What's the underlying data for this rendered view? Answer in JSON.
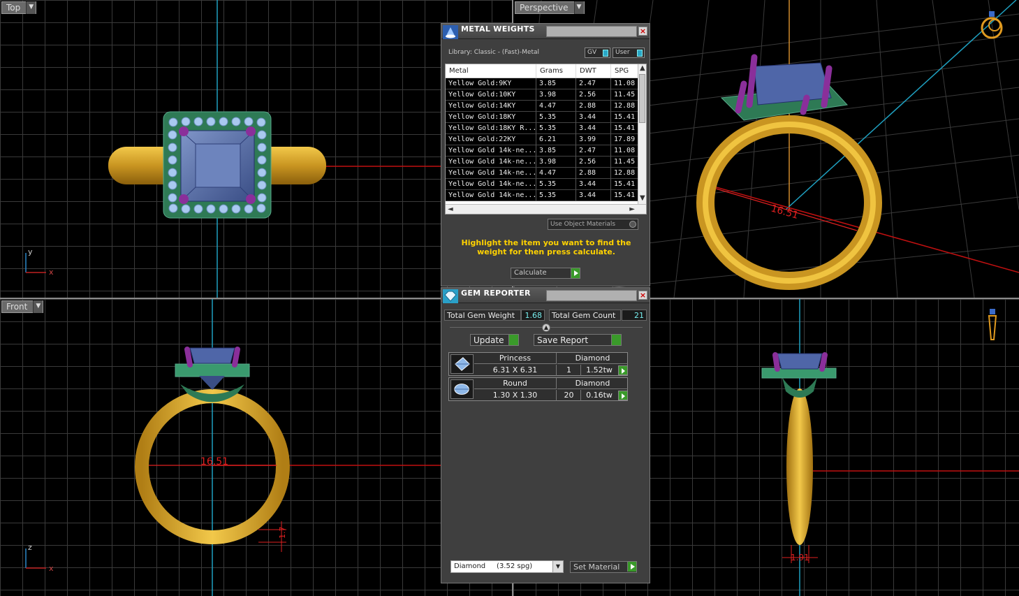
{
  "viewports": {
    "top": {
      "label": "Top",
      "axis_a": "y",
      "axis_b": "x"
    },
    "perspective": {
      "label": "Perspective",
      "dim1": "16.51"
    },
    "front": {
      "label": "Front",
      "axis_a": "z",
      "axis_b": "x",
      "dim1": "16.51",
      "dim2": "1.7"
    },
    "right": {
      "dim1": "1.91"
    }
  },
  "metal_weights": {
    "title": "METAL WEIGHTS",
    "library": "Library: Classic - (Fast)-Metal",
    "toggle_gv": "GV",
    "toggle_user": "User",
    "columns": [
      "Metal",
      "Grams",
      "DWT",
      "SPG"
    ],
    "rows": [
      [
        "Yellow Gold:9KY",
        "3.85",
        "2.47",
        "11.08"
      ],
      [
        "Yellow Gold:10KY",
        "3.98",
        "2.56",
        "11.45"
      ],
      [
        "Yellow Gold:14KY",
        "4.47",
        "2.88",
        "12.88"
      ],
      [
        "Yellow Gold:18KY",
        "5.35",
        "3.44",
        "15.41"
      ],
      [
        "Yellow Gold:18KY R...",
        "5.35",
        "3.44",
        "15.41"
      ],
      [
        "Yellow Gold:22KY",
        "6.21",
        "3.99",
        "17.89"
      ],
      [
        "Yellow Gold 14k-ne...",
        "3.85",
        "2.47",
        "11.08"
      ],
      [
        "Yellow Gold 14k-ne...",
        "3.98",
        "2.56",
        "11.45"
      ],
      [
        "Yellow Gold 14k-ne...",
        "4.47",
        "2.88",
        "12.88"
      ],
      [
        "Yellow Gold 14k-ne...",
        "5.35",
        "3.44",
        "15.41"
      ],
      [
        "Yellow Gold 14k-ne...",
        "5.35",
        "3.44",
        "15.41"
      ]
    ],
    "use_object_materials": "Use Object Materials",
    "hint": "Highlight the item you want to find the weight for then press calculate.",
    "calculate": "Calculate"
  },
  "gem_reporter": {
    "title": "GEM REPORTER",
    "total_weight_label": "Total Gem Weight",
    "total_weight_value": "1.68",
    "total_count_label": "Total Gem Count",
    "total_count_value": "21",
    "update": "Update",
    "save_report": "Save Report",
    "gems": [
      {
        "shape": "Princess",
        "material": "Diamond",
        "size": "6.31 X 6.31",
        "count": "1",
        "weight": "1.52tw"
      },
      {
        "shape": "Round",
        "material": "Diamond",
        "size": "1.30 X 1.30",
        "count": "20",
        "weight": "0.16tw"
      }
    ],
    "material_select": "Diamond     (3.52 spg)",
    "set_material": "Set Material"
  }
}
